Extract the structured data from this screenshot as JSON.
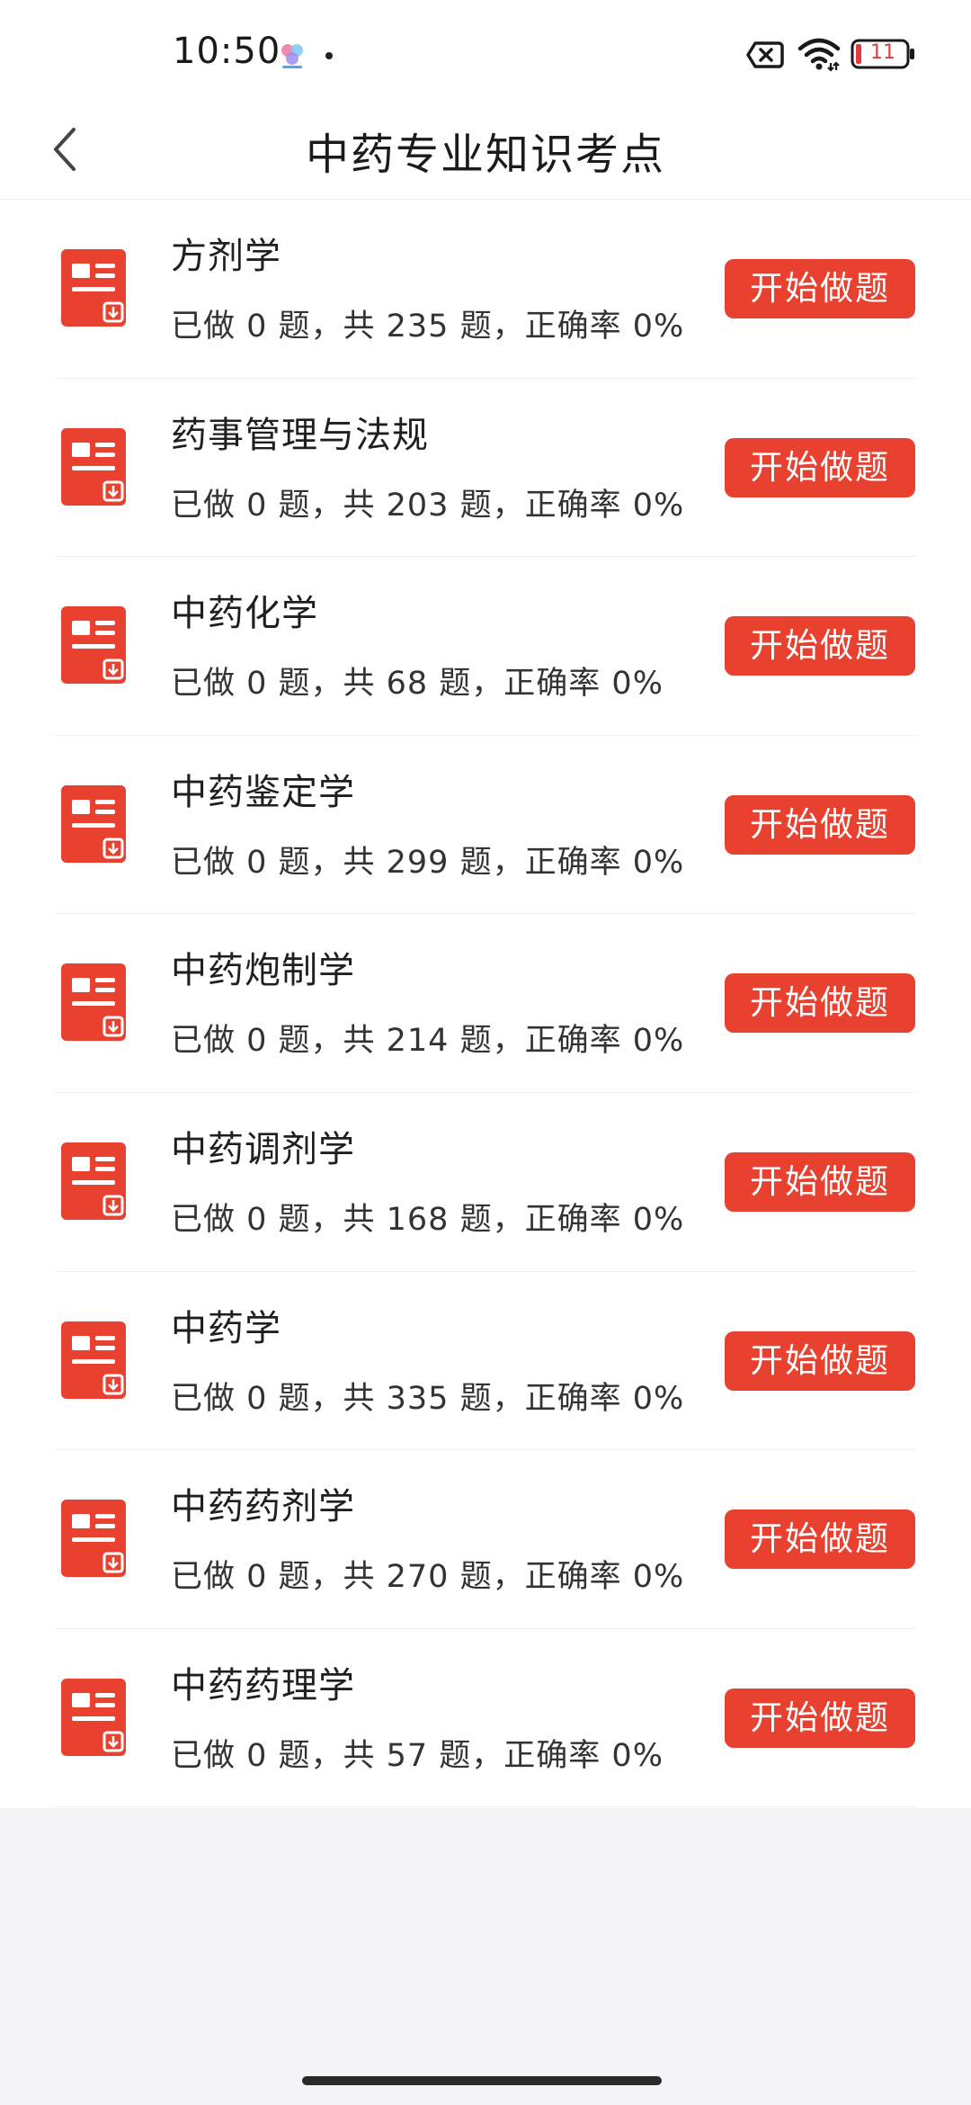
{
  "status_bar": {
    "time": "10:50",
    "battery": "11",
    "icons": [
      "app-notification-icon",
      "sim-no-signal-icon",
      "wifi-icon",
      "battery-icon"
    ]
  },
  "header": {
    "title": "中药专业知识考点",
    "back_icon": "chevron-left-icon"
  },
  "colors": {
    "accent": "#e8412f",
    "background": "#f4f4f6",
    "card": "#ffffff"
  },
  "list": {
    "items": [
      {
        "title": "方剂学",
        "stats": "已做 0 题，共 235 题，正确率 0%",
        "button": "开始做题"
      },
      {
        "title": "药事管理与法规",
        "stats": "已做 0 题，共 203 题，正确率 0%",
        "button": "开始做题"
      },
      {
        "title": "中药化学",
        "stats": "已做 0 题，共 68 题，正确率 0%",
        "button": "开始做题"
      },
      {
        "title": "中药鉴定学",
        "stats": "已做 0 题，共 299 题，正确率 0%",
        "button": "开始做题"
      },
      {
        "title": "中药炮制学",
        "stats": "已做 0 题，共 214 题，正确率 0%",
        "button": "开始做题"
      },
      {
        "title": "中药调剂学",
        "stats": "已做 0 题，共 168 题，正确率 0%",
        "button": "开始做题"
      },
      {
        "title": "中药学",
        "stats": "已做 0 题，共 335 题，正确率 0%",
        "button": "开始做题"
      },
      {
        "title": "中药药剂学",
        "stats": "已做 0 题，共 270 题，正确率 0%",
        "button": "开始做题"
      },
      {
        "title": "中药药理学",
        "stats": "已做 0 题，共 57 题，正确率 0%",
        "button": "开始做题"
      }
    ]
  }
}
